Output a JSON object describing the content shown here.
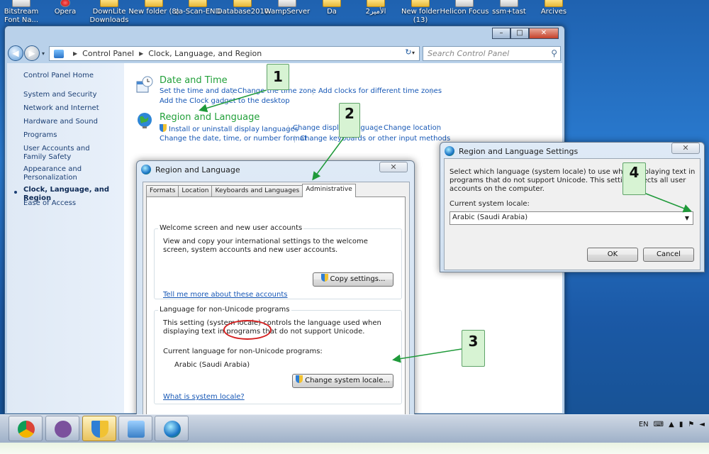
{
  "desktop": {
    "icons": [
      {
        "label": "Bitstream Font Na...",
        "icon": "font-icon"
      },
      {
        "label": "Opera",
        "icon": "opera-icon"
      },
      {
        "label": "DownLite Downloads",
        "icon": "folder-icon"
      },
      {
        "label": "New folder (8)",
        "icon": "folder-icon"
      },
      {
        "label": "za-Scan-END",
        "icon": "folder-icon"
      },
      {
        "label": "Database2010",
        "icon": "folder-icon"
      },
      {
        "label": "WampServer",
        "icon": "wamp-icon"
      },
      {
        "label": "Da",
        "icon": "folder-icon"
      },
      {
        "label": "الأمير2",
        "icon": "folder-icon"
      },
      {
        "label": "New folder (13)",
        "icon": "folder-icon"
      },
      {
        "label": "Helicon Focus",
        "icon": "helicon-icon"
      },
      {
        "label": "ssm+tast",
        "icon": "document-icon"
      },
      {
        "label": "Arcives",
        "icon": "folder-icon"
      }
    ]
  },
  "control_panel": {
    "caption": {
      "minimize": "–",
      "maximize": "□",
      "close": "✕"
    },
    "nav": {
      "back": "◀",
      "forward": "▶",
      "dropdown": "▾",
      "refresh": "↻"
    },
    "breadcrumb": [
      "Control Panel",
      "Clock, Language, and Region"
    ],
    "search_placeholder": "Search Control Panel",
    "sidebar": {
      "items": [
        {
          "label": "Control Panel Home"
        },
        {
          "label": "System and Security"
        },
        {
          "label": "Network and Internet"
        },
        {
          "label": "Hardware and Sound"
        },
        {
          "label": "Programs"
        },
        {
          "label": "User Accounts and Family Safety"
        },
        {
          "label": "Appearance and Personalization"
        },
        {
          "label": "Clock, Language, and Region",
          "current": true
        },
        {
          "label": "Ease of Access"
        }
      ]
    },
    "categories": {
      "date_time": {
        "title": "Date and Time",
        "links": [
          "Set the time and date",
          "Change the time zone",
          "Add clocks for different time zones",
          "Add the Clock gadget to the desktop"
        ]
      },
      "region_language": {
        "title": "Region and Language",
        "links": [
          "Install or uninstall display languages",
          "Change display language",
          "Change location",
          "Change the date, time, or number format",
          "Change keyboards or other input methods"
        ]
      }
    }
  },
  "region_dialog": {
    "title": "Region and Language",
    "close": "✕",
    "tabs": [
      "Formats",
      "Location",
      "Keyboards and Languages",
      "Administrative"
    ],
    "active_tab": "Administrative",
    "welcome_group": {
      "title": "Welcome screen and new user accounts",
      "text": "View and copy your international settings to the welcome screen, system accounts and new user accounts.",
      "button": "Copy settings...",
      "link": "Tell me more about these accounts"
    },
    "unicode_group": {
      "title": "Language for non-Unicode programs",
      "text": "This setting (system locale) controls the language used when displaying text in programs that do not support Unicode.",
      "current_label": "Current language for non-Unicode programs:",
      "current_value": "Arabic (Saudi Arabia)",
      "button": "Change system locale...",
      "link": "What is system locale?"
    }
  },
  "settings_dialog": {
    "title": "Region and Language Settings",
    "close": "✕",
    "text": "Select which language (system locale) to use when displaying text in programs that do not support Unicode. This setting affects all user accounts on the computer.",
    "locale_label": "Current system locale:",
    "locale_value": "Arabic (Saudi Arabia)",
    "ok": "OK",
    "cancel": "Cancel"
  },
  "annotations": {
    "callout_1": "1",
    "callout_2": "2",
    "callout_3": "3",
    "callout_4": "4",
    "arrow_color": "#1f9a3a"
  },
  "taskbar": {
    "buttons": [
      {
        "icon": "chrome-icon"
      },
      {
        "icon": "viber-icon"
      },
      {
        "icon": "security-shield-icon",
        "active": true
      },
      {
        "icon": "control-panel-icon"
      },
      {
        "icon": "region-globe-icon"
      }
    ],
    "tray": {
      "lang": "EN"
    }
  }
}
